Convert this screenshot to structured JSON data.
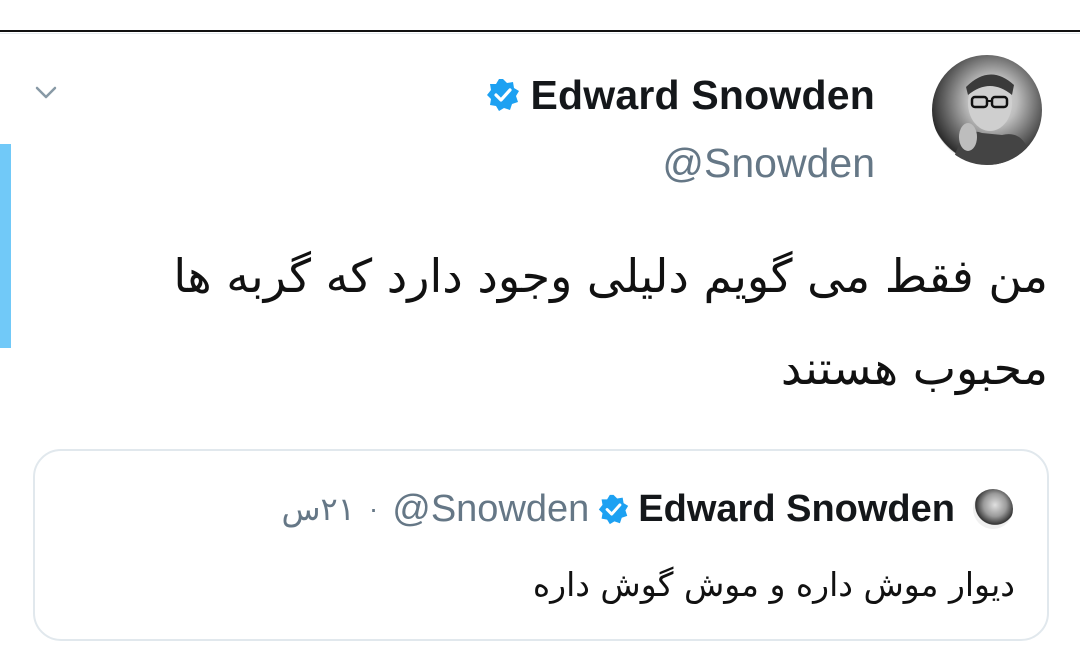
{
  "tweet": {
    "author_name": "Edward Snowden",
    "author_handle": "@Snowden",
    "text": "من فقط می گویم دلیلی وجود دارد که گربه ها محبوب هستند"
  },
  "quoted_tweet": {
    "author_name": "Edward Snowden",
    "author_handle": "@Snowden",
    "separator": "·",
    "time": "۲۱س",
    "text": "دیوار موش داره و موش گوش داره"
  },
  "colors": {
    "accent_bar": "#71c9f8",
    "verified": "#1da1f2",
    "secondary_text": "#657786",
    "border": "#e1e8ed"
  },
  "icons": {
    "menu": "chevron-down-icon",
    "verified": "verified-badge-icon"
  }
}
